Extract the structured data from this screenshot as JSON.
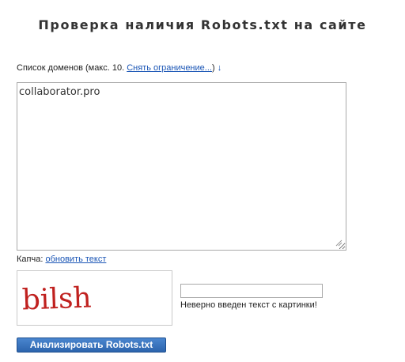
{
  "page": {
    "title": "Проверка наличия Robots.txt на сайте"
  },
  "domains": {
    "label_prefix": "Список доменов (макс. 10. ",
    "remove_limit_link": "Снять ограничение...",
    "label_suffix": ")",
    "arrow": "↓",
    "value": "collaborator.pro"
  },
  "captcha": {
    "label": "Капча: ",
    "refresh_link": "обновить текст",
    "image_text": "bilsh",
    "input_value": "",
    "error": "Неверно введен текст с картинки!"
  },
  "submit": {
    "label": "Анализировать Robots.txt"
  },
  "colors": {
    "link": "#1a55b5",
    "button": "#3a74be",
    "captcha_text": "#c0211f"
  }
}
